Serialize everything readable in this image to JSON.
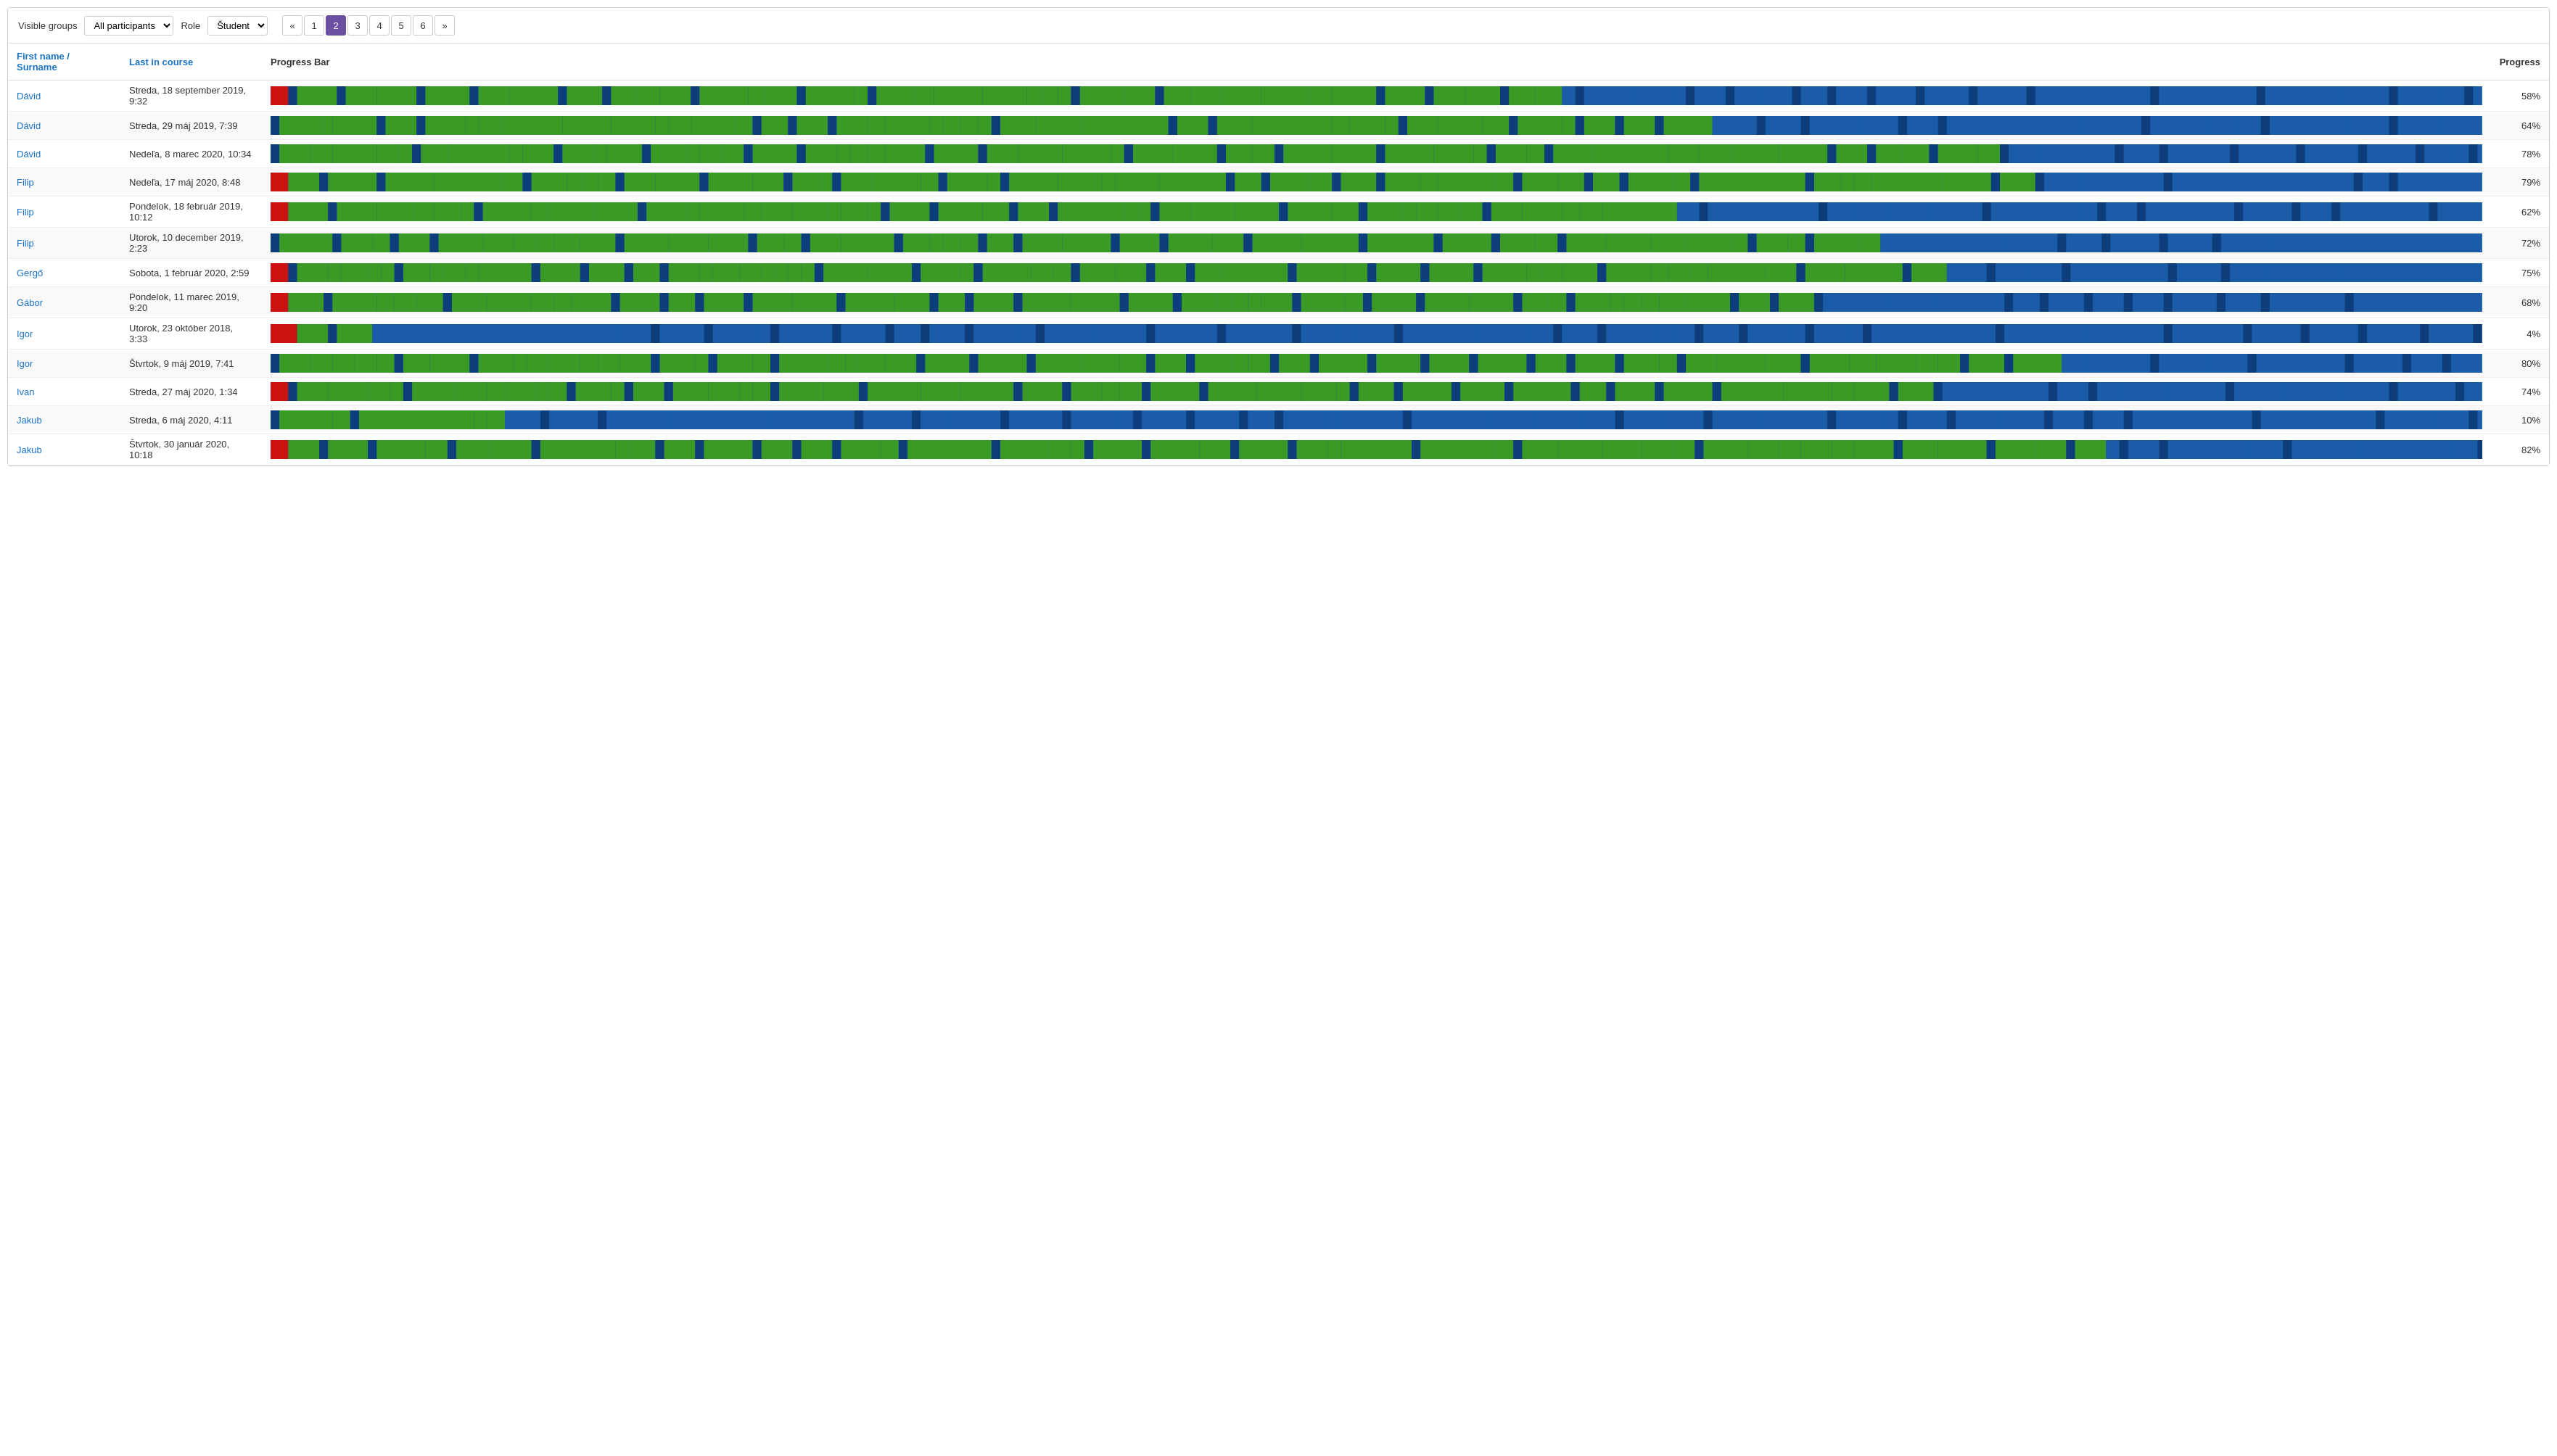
{
  "toolbar": {
    "visible_groups_label": "Visible groups",
    "visible_groups_value": "All participants",
    "role_label": "Role",
    "role_value": "Študent"
  },
  "pagination": {
    "prev": "«",
    "pages": [
      "1",
      "2",
      "3",
      "4",
      "5",
      "6"
    ],
    "next": "»",
    "active": "2"
  },
  "table": {
    "headers": {
      "name": "First name / Surname",
      "last_in_course": "Last in course",
      "progress_bar": "Progress Bar",
      "progress": "Progress"
    },
    "rows": [
      {
        "name": "Dávid",
        "date": "Streda, 18 september 2019, 9:32",
        "progress": "58%",
        "bar": "58"
      },
      {
        "name": "Dávid",
        "date": "Streda, 29 máj 2019, 7:39",
        "progress": "64%",
        "bar": "64"
      },
      {
        "name": "Dávid",
        "date": "Nedeľa, 8 marec 2020, 10:34",
        "progress": "78%",
        "bar": "78"
      },
      {
        "name": "Filip",
        "date": "Nedeľa, 17 máj 2020, 8:48",
        "progress": "79%",
        "bar": "79"
      },
      {
        "name": "Filip",
        "date": "Pondelok, 18 február 2019, 10:12",
        "progress": "62%",
        "bar": "62"
      },
      {
        "name": "Filip",
        "date": "Utorok, 10 december 2019, 2:23",
        "progress": "72%",
        "bar": "72"
      },
      {
        "name": "Gergő",
        "date": "Sobota, 1 február 2020, 2:59",
        "progress": "75%",
        "bar": "75"
      },
      {
        "name": "Gábor",
        "date": "Pondelok, 11 marec 2019, 9:20",
        "progress": "68%",
        "bar": "68"
      },
      {
        "name": "Igor",
        "date": "Utorok, 23 október 2018, 3:33",
        "progress": "4%",
        "bar": "4"
      },
      {
        "name": "Igor",
        "date": "Štvrtok, 9 máj 2019, 7:41",
        "progress": "80%",
        "bar": "80"
      },
      {
        "name": "Ivan",
        "date": "Streda, 27 máj 2020, 1:34",
        "progress": "74%",
        "bar": "74"
      },
      {
        "name": "Jakub",
        "date": "Streda, 6 máj 2020, 4:11",
        "progress": "10%",
        "bar": "10"
      },
      {
        "name": "Jakub",
        "date": "Štvrtok, 30 január 2020, 10:18",
        "progress": "82%",
        "bar": "82"
      }
    ]
  }
}
